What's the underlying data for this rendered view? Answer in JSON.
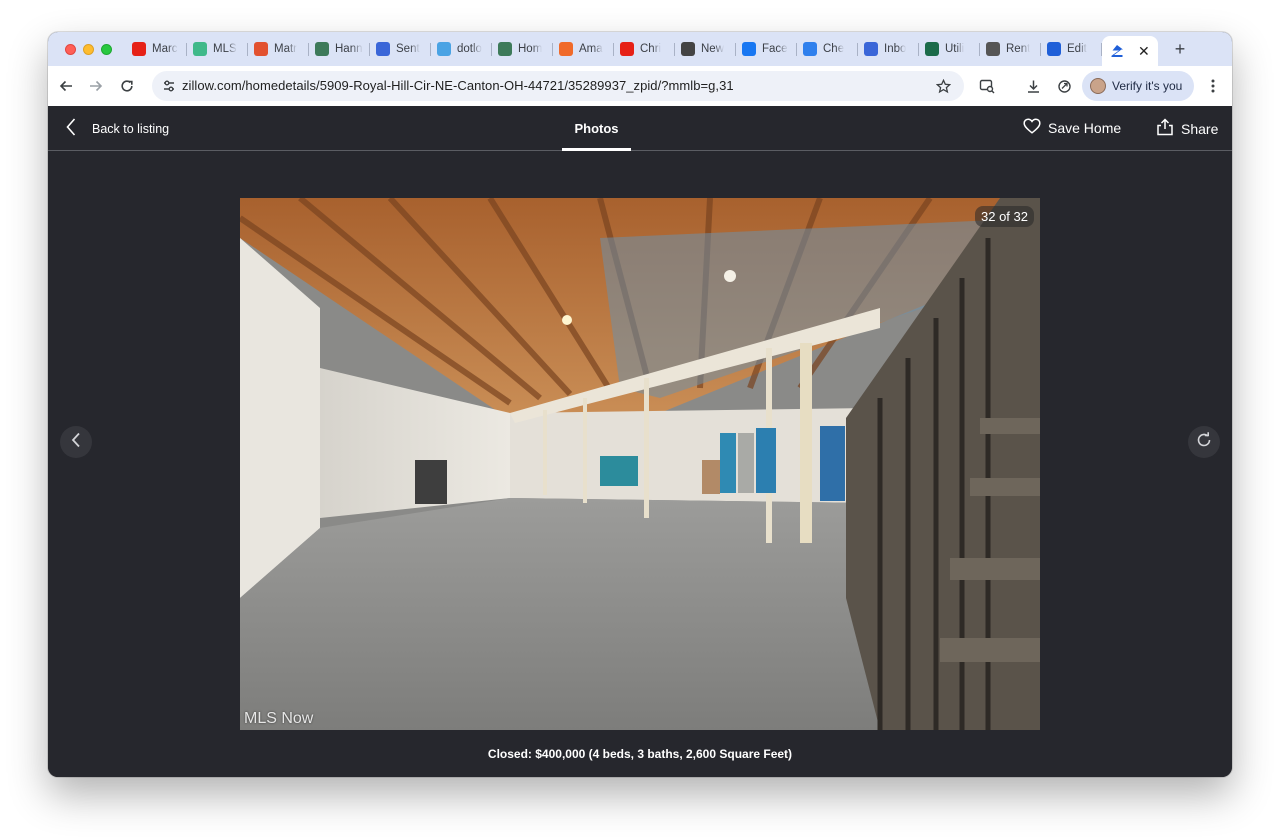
{
  "browser": {
    "tabs": [
      {
        "label": "Marc",
        "icon": "youtube-icon",
        "color": "#e62117"
      },
      {
        "label": "MLS",
        "icon": "mls-icon",
        "color": "#3fb98a"
      },
      {
        "label": "Matr",
        "icon": "matrix-icon",
        "color": "#e2512f"
      },
      {
        "label": "Hann",
        "icon": "hanna-icon",
        "color": "#3d7a5a"
      },
      {
        "label": "Sent",
        "icon": "sent-icon",
        "color": "#3a66d8"
      },
      {
        "label": "dotlo",
        "icon": "dotloop-icon",
        "color": "#4aa3e4"
      },
      {
        "label": "Hom",
        "icon": "hom-icon",
        "color": "#3d7a5a"
      },
      {
        "label": "Ama",
        "icon": "amazon-icon",
        "color": "#f06a2a"
      },
      {
        "label": "Chri",
        "icon": "youtube-icon",
        "color": "#e62117"
      },
      {
        "label": "New",
        "icon": "chrome-icon",
        "color": "#444"
      },
      {
        "label": "Face",
        "icon": "facebook-icon",
        "color": "#1877f2"
      },
      {
        "label": "Che",
        "icon": "docs-icon",
        "color": "#2f80ed"
      },
      {
        "label": "Inbo",
        "icon": "inbox-icon",
        "color": "#3a66d8"
      },
      {
        "label": "Utili",
        "icon": "utility-icon",
        "color": "#1b6b4a"
      },
      {
        "label": "Rent",
        "icon": "rent-icon",
        "color": "#555"
      },
      {
        "label": "Edit",
        "icon": "zillow-icon",
        "color": "#1f5fd8"
      }
    ],
    "active_tab": {
      "icon": "zillow-icon",
      "close": "✕"
    },
    "new_tab_label": "+",
    "url": "zillow.com/homedetails/5909-Royal-Hill-Cir-NE-Canton-OH-44721/35289937_zpid/?mmlb=g,31",
    "verify_label": "Verify it's you"
  },
  "header": {
    "back_label": "Back to listing",
    "photos_tab": "Photos",
    "save_label": "Save Home",
    "share_label": "Share"
  },
  "viewer": {
    "counter": "32 of 32",
    "watermark": "MLS Now",
    "caption": "Closed: $400,000 (4 beds, 3 baths, 2,600 Square Feet)",
    "current_photo": 32,
    "total_photos": 32
  }
}
